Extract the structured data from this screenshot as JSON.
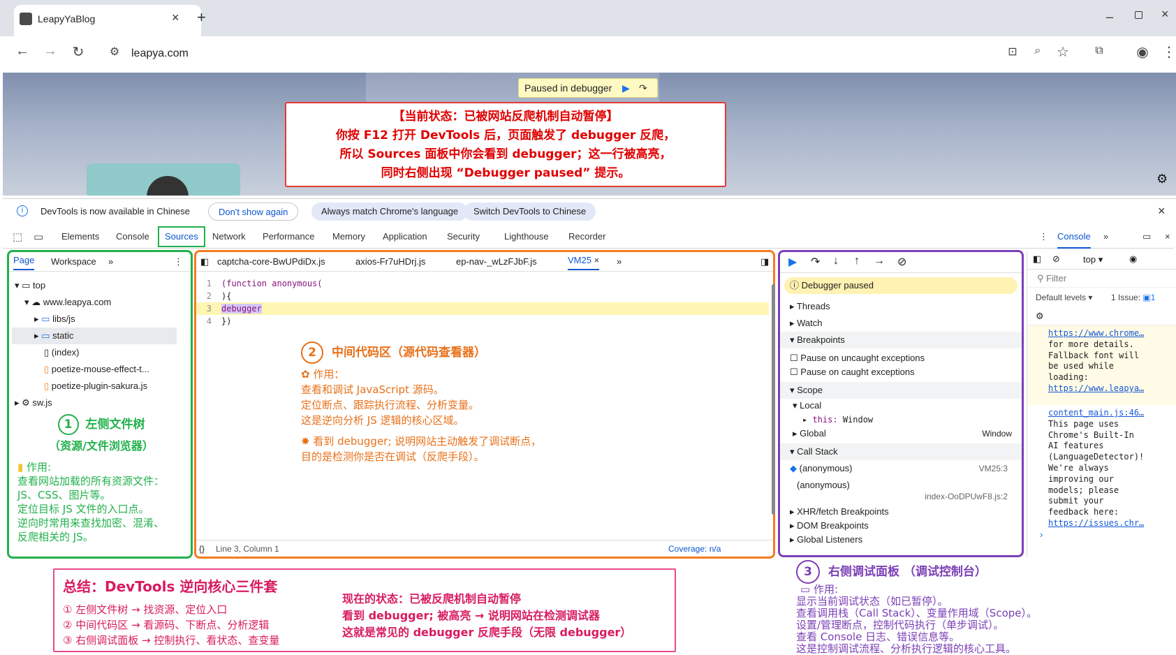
{
  "browser": {
    "tab_title": "LeapyYaBlog",
    "url": "leapya.com"
  },
  "page": {
    "paused_text": "Paused in debugger"
  },
  "top_annotation": {
    "lines": [
      "【当前状态：已被网站反爬机制自动暂停】",
      "你按 F12 打开 DevTools 后，页面触发了 debugger 反爬，",
      "所以 Sources 面板中你会看到 debugger；这一行被高亮，",
      "同时右侧出现 “Debugger paused” 提示。"
    ]
  },
  "infobar": {
    "message": "DevTools is now available in Chinese",
    "btn_dont_show": "Don't show again",
    "btn_match": "Always match Chrome's language",
    "btn_switch": "Switch DevTools to Chinese"
  },
  "devtools_tabs": [
    "Elements",
    "Console",
    "Sources",
    "Network",
    "Performance",
    "Memory",
    "Application",
    "Security",
    "Lighthouse",
    "Recorder"
  ],
  "left_panel": {
    "tabs": [
      "Page",
      "Workspace"
    ],
    "tree": [
      {
        "label": "top",
        "depth": 0
      },
      {
        "label": "www.leapya.com",
        "depth": 1
      },
      {
        "label": "libs/js",
        "depth": 2
      },
      {
        "label": "static",
        "depth": 2
      },
      {
        "label": "(index)",
        "depth": 2
      },
      {
        "label": "poetize-mouse-effect-t...",
        "depth": 2
      },
      {
        "label": "poetize-plugin-sakura.js",
        "depth": 2
      },
      {
        "label": "sw.js",
        "depth": 0
      }
    ]
  },
  "editor": {
    "tabs": [
      "captcha-core-BwUPdiDx.js",
      "axios-Fr7uHDrj.js",
      "ep-nav-_wLzFJbF.js",
      "VM25"
    ],
    "lines": [
      "(function anonymous(",
      "){",
      "debugger",
      "})"
    ],
    "status_pos": "Line 3, Column 1",
    "status_cov": "Coverage: n/a"
  },
  "right_panel": {
    "paused": "Debugger paused",
    "threads": "Threads",
    "watch": "Watch",
    "breakpoints": "Breakpoints",
    "pause_uncaught": "Pause on uncaught exceptions",
    "pause_caught": "Pause on caught exceptions",
    "scope": "Scope",
    "local": "Local",
    "this_key": "this:",
    "this_val": "Window",
    "global": "Global",
    "global_val": "Window",
    "callstack": "Call Stack",
    "frame1": "(anonymous)",
    "frame1_loc": "VM25:3",
    "frame2": "(anonymous)",
    "frame2_loc": "index-OoDPUwF8.js:2",
    "xhr": "XHR/fetch Breakpoints",
    "dom": "DOM Breakpoints",
    "listeners": "Global Listeners"
  },
  "console_panel": {
    "tab": "Console",
    "top": "top",
    "filter": "Filter",
    "levels": "Default levels",
    "issues": "1 Issue:",
    "issue_count": "1",
    "lines": [
      "https://www.chrome…",
      "for more details.",
      "Fallback font will",
      "be used while",
      "loading:",
      "https://www.leapya…",
      "content_main.js:46…",
      "This page uses",
      "Chrome's Built-In",
      "AI features",
      "(LanguageDetector)!",
      "We're always",
      "improving our",
      "models; please",
      "submit your",
      "feedback here:",
      "https://issues.chr…"
    ]
  },
  "annot_left": {
    "num": "1",
    "title": "左侧文件树",
    "subtitle": "（资源/文件浏览器）",
    "use": "作用:",
    "lines": [
      "查看网站加载的所有资源文件：",
      "JS、CSS、图片等。",
      "定位目标 JS 文件的入口点。",
      "逆向时常用来查找加密、混淆、",
      "反爬相关的 JS。"
    ]
  },
  "annot_mid": {
    "num": "2",
    "title": "中间代码区（源代码查看器）",
    "use": "作用：",
    "lines": [
      "查看和调试 JavaScript 源码。",
      "定位断点、跟踪执行流程、分析变量。",
      "这是逆向分析 JS 逻辑的核心区域。"
    ],
    "note1": "看到 debugger; 说明网站主动触发了调试断点，",
    "note2": "目的是检测你是否在调试（反爬手段）。"
  },
  "annot_right": {
    "num": "3",
    "title": "右侧调试面板 （调试控制台）",
    "use": "作用:",
    "lines": [
      "显示当前调试状态（如已暂停）。",
      "查看调用栈（Call Stack）、变量作用域（Scope）。",
      "设置/管理断点，控制代码执行（单步调试）。",
      "查看 Console 日志、错误信息等。",
      "这是控制调试流程、分析执行逻辑的核心工具。"
    ]
  },
  "summary": {
    "title": "总结：DevTools 逆向核心三件套",
    "items": [
      "① 左侧文件树 → 找资源、定位入口",
      "② 中间代码区 → 看源码、下断点、分析逻辑",
      "③ 右侧调试面板 → 控制执行、看状态、查变量"
    ],
    "now_title": "现在的状态：已被反爬机制自动暂停",
    "now_lines": [
      "看到 debugger; 被高亮 → 说明网站在检测调试器",
      "这就是常见的 debugger 反爬手段（无限 debugger）"
    ]
  },
  "colors": {
    "green": "#22b14c",
    "orange": "#f47c20",
    "purple": "#7b3fb6",
    "red": "#e53935",
    "pink": "#e84a8a",
    "blue": "#0b57d0"
  }
}
